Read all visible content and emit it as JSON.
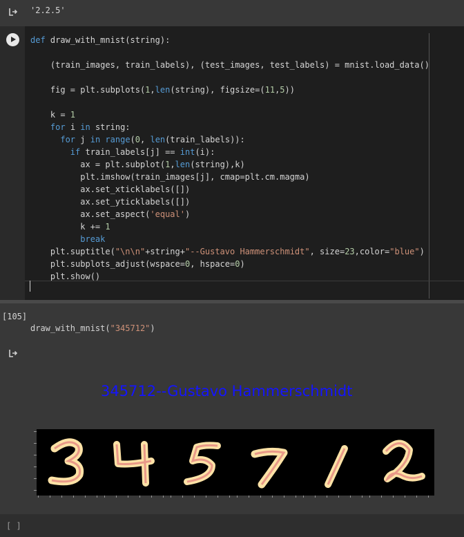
{
  "top_output": {
    "text": "'2.2.5'"
  },
  "code_cell": {
    "lines": [
      "def draw_with_mnist(string):",
      "",
      "    (train_images, train_labels), (test_images, test_labels) = mnist.load_data()",
      "",
      "    fig = plt.subplots(1,len(string), figsize=(11,5))",
      "",
      "    k = 1",
      "    for i in string:",
      "      for j in range(0, len(train_labels)):",
      "        if train_labels[j] == int(i):",
      "          ax = plt.subplot(1,len(string),k)",
      "          plt.imshow(train_images[j], cmap=plt.cm.magma)",
      "          ax.set_xticklabels([])",
      "          ax.set_yticklabels([])",
      "          ax.set_aspect('equal')",
      "          k += 1",
      "          break",
      "    plt.suptitle(\"\\n\\n\"+string+\"--Gustavo Hammerschmidt\", size=23,color=\"blue\")",
      "    plt.subplots_adjust(wspace=0, hspace=0)",
      "    plt.show()"
    ]
  },
  "second_cell": {
    "execution_count": "[105]",
    "code": "draw_with_mnist(\"345712\")"
  },
  "output": {
    "suptitle": "345712--Gustavo Hammerschmidt",
    "suptitle_color": "#1414ff",
    "digits": [
      "3",
      "4",
      "5",
      "7",
      "1",
      "2"
    ]
  },
  "empty_cell": {
    "bracket": "[ ]"
  },
  "icons": {
    "output": "output-arrow-icon",
    "run": "play-icon"
  }
}
